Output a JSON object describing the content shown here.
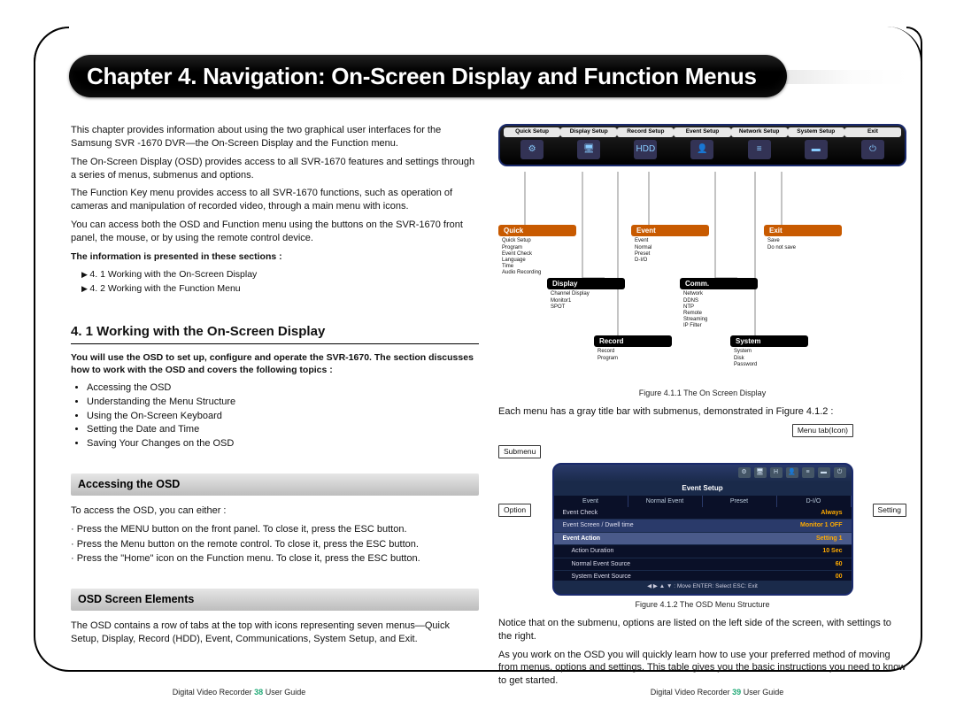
{
  "chapter": {
    "title": "Chapter 4. Navigation: On-Screen Display and Function Menus"
  },
  "left": {
    "intro": [
      "This chapter provides information about using the two graphical user interfaces for the Samsung SVR -1670 DVR—the On-Screen Display and the Function menu.",
      "The On-Screen Display (OSD) provides access to all SVR-1670 features and settings through a series of menus, submenus and options.",
      "The Function Key menu provides access to all SVR-1670 functions, such as operation of cameras and manipulation of recorded video, through a main menu with icons.",
      "You can access both the OSD and Function menu using the buttons on the SVR-1670 front panel, the mouse, or by using the remote control device."
    ],
    "sections_head": "The information is presented in these sections :",
    "sections": [
      "4. 1 Working with the On-Screen Display",
      "4. 2 Working with the Function Menu"
    ],
    "h41": "4. 1 Working with the On-Screen Display",
    "h41_intro": "You will use the OSD to set up, configure and operate the SVR-1670. The section discusses how to work with the OSD and covers the following topics :",
    "h41_bullets": [
      "Accessing the OSD",
      "Understanding the Menu Structure",
      "Using the On-Screen Keyboard",
      "Setting the Date and Time",
      "Saving Your Changes on the OSD"
    ],
    "accessing_title": "Accessing the OSD",
    "accessing_lead": "To access the OSD, you can either :",
    "accessing_items": [
      "· Press the MENU button on the front panel. To close it, press the ESC button.",
      "· Press the Menu button on the remote control. To close it, press the ESC button.",
      "· Press the \"Home\" icon on the Function menu. To close it, press the ESC button."
    ],
    "elements_title": "OSD Screen Elements",
    "elements_body": "The OSD contains a row of tabs at the top with icons representing seven menus—Quick Setup, Display, Record (HDD), Event, Communications, System Setup, and Exit."
  },
  "right": {
    "icon_tabs": [
      "Quick Setup",
      "Display Setup",
      "Record Setup",
      "Event Setup",
      "Network Setup",
      "System Setup",
      "Exit"
    ],
    "nodes": {
      "quick": {
        "label": "Quick",
        "items": [
          "Quick Setup",
          "Program",
          "Event Check",
          "Language",
          "Time",
          "Audio Recording"
        ]
      },
      "event": {
        "label": "Event",
        "items": [
          "Event",
          "Normal",
          "Preset",
          "D-I/O"
        ]
      },
      "exit": {
        "label": "Exit",
        "items": [
          "Save",
          "Do not save"
        ]
      },
      "display": {
        "label": "Display",
        "items": [
          "Channel Display",
          "Monitor1",
          "SPOT"
        ]
      },
      "comm": {
        "label": "Comm.",
        "items": [
          "Network",
          "DDNS",
          "NTP",
          "Remote",
          "Streaming",
          "IP Filter"
        ]
      },
      "record": {
        "label": "Record",
        "items": [
          "Record",
          "Program"
        ]
      },
      "system": {
        "label": "System",
        "items": [
          "System",
          "Disk",
          "Password"
        ]
      }
    },
    "fig411": "Figure 4.1.1 The On Screen Display",
    "each_menu": "Each menu has a gray title bar with submenus, demonstrated in Figure 4.1.2 :",
    "labels": {
      "menutab": "Menu tab(Icon)",
      "submenu": "Submenu",
      "option": "Option",
      "setting": "Setting"
    },
    "osd": {
      "title": "Event Setup",
      "tabs": [
        "Event",
        "Normal Event",
        "Preset",
        "D-I/O"
      ],
      "rows": [
        {
          "l": "Event Check",
          "r": "Always",
          "sel": false,
          "hd": false
        },
        {
          "l": "Event Screen / Dwell time",
          "r": "Monitor 1    OFF",
          "sel": true,
          "hd": false
        },
        {
          "l": "Event Action",
          "r": "Setting 1",
          "sel": false,
          "hd": true
        },
        {
          "l": "Action Duration",
          "r": "10 Sec",
          "sel": false,
          "hd": false
        },
        {
          "l": "Normal Event Source",
          "r": "60",
          "sel": false,
          "hd": false
        },
        {
          "l": "System Event Source",
          "r": "00",
          "sel": false,
          "hd": false
        }
      ],
      "foot": "◀ ▶ ▲ ▼ : Move      ENTER: Select      ESC: Exit"
    },
    "fig412": "Figure 4.1.2 The OSD Menu Structure",
    "after": [
      "Notice that on the submenu, options are listed on the left side of the screen, with settings to the right.",
      "As you work on the OSD you will quickly learn how to use your preferred method of moving from menus, options and settings. This table gives you the basic instructions you need to know to get started."
    ]
  },
  "footer": {
    "left": {
      "pre": "Digital Video Recorder",
      "num": "38",
      "post": "User Guide"
    },
    "right": {
      "pre": "Digital Video Recorder",
      "num": "39",
      "post": "User Guide"
    }
  }
}
